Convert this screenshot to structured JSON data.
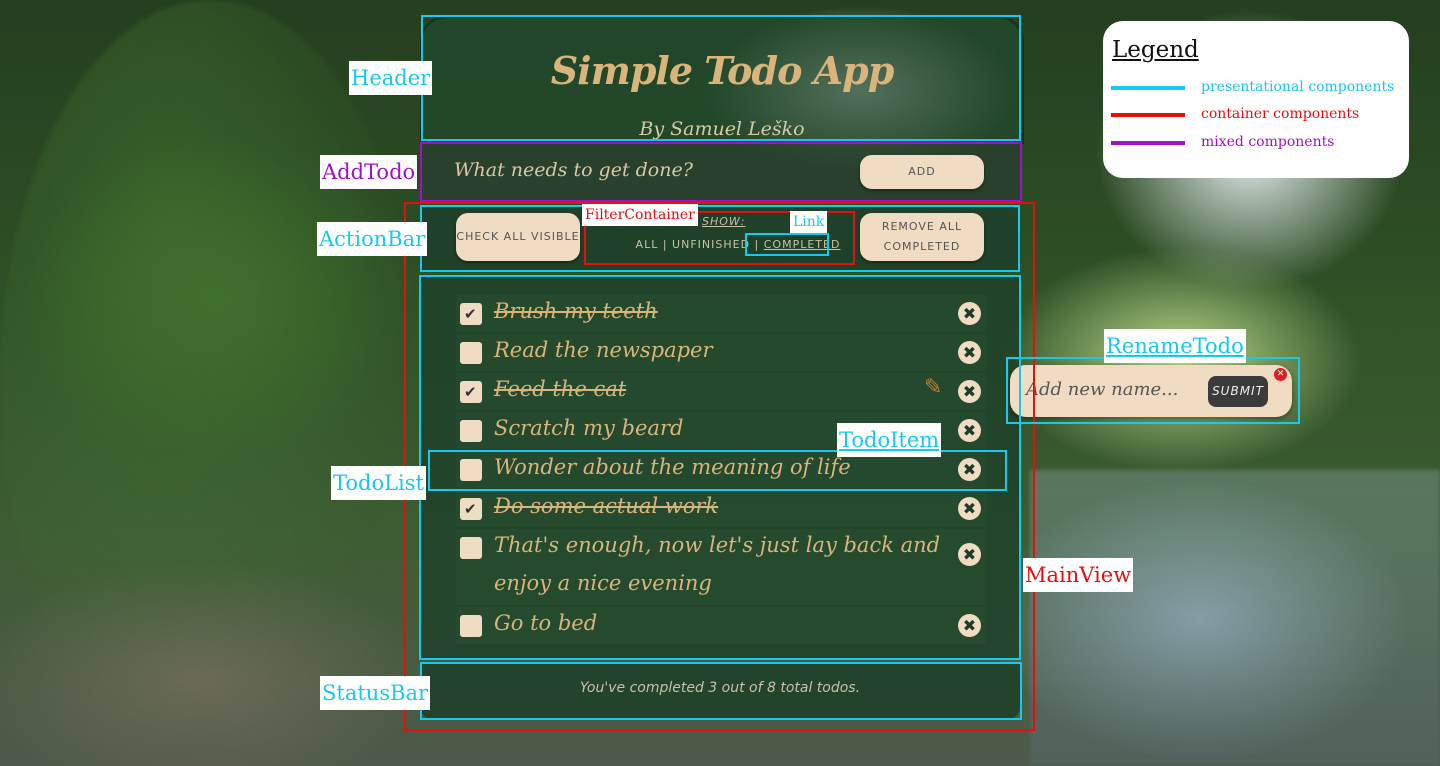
{
  "app": {
    "title": "Simple Todo App",
    "subtitle": "By Samuel Leško",
    "add_placeholder": "What needs to get done?",
    "add_button": "ADD",
    "check_all_button": "CHECK ALL VISIBLE",
    "show_label": "SHOW:",
    "filters": [
      "ALL",
      "UNFINISHED",
      "COMPLETED"
    ],
    "filter_separator": " | ",
    "remove_button": "REMOVE ALL COMPLETED",
    "todos": [
      {
        "text": "Brush my teeth",
        "done": true
      },
      {
        "text": "Read the newspaper",
        "done": false
      },
      {
        "text": "Feed the cat",
        "done": true,
        "editing": true
      },
      {
        "text": "Scratch my beard",
        "done": false
      },
      {
        "text": "Wonder about the meaning of life",
        "done": false
      },
      {
        "text": "Do some actual work",
        "done": true
      },
      {
        "text": "That's enough, now let's just lay back and",
        "text2": "enjoy a nice evening",
        "done": false
      },
      {
        "text": "Go to bed",
        "done": false
      }
    ],
    "status": "You've completed 3 out of 8 total todos.",
    "rename_placeholder": "Add new name...",
    "rename_submit": "SUBMIT"
  },
  "annotations": {
    "header": "Header",
    "addtodo": "AddTodo",
    "actionbar": "ActionBar",
    "filtercontainer": "FilterContainer",
    "link": "Link",
    "todolist": "TodoList",
    "todoitem": "TodoItem",
    "statusbar": "StatusBar",
    "mainview": "MainView",
    "renametodo": "RenameTodo"
  },
  "legend": {
    "title": "Legend",
    "items": [
      {
        "label": "presentational components",
        "color": "#18c8ef"
      },
      {
        "label": "container components",
        "color": "#e41010"
      },
      {
        "label": "mixed components",
        "color": "#a012c8"
      }
    ]
  }
}
